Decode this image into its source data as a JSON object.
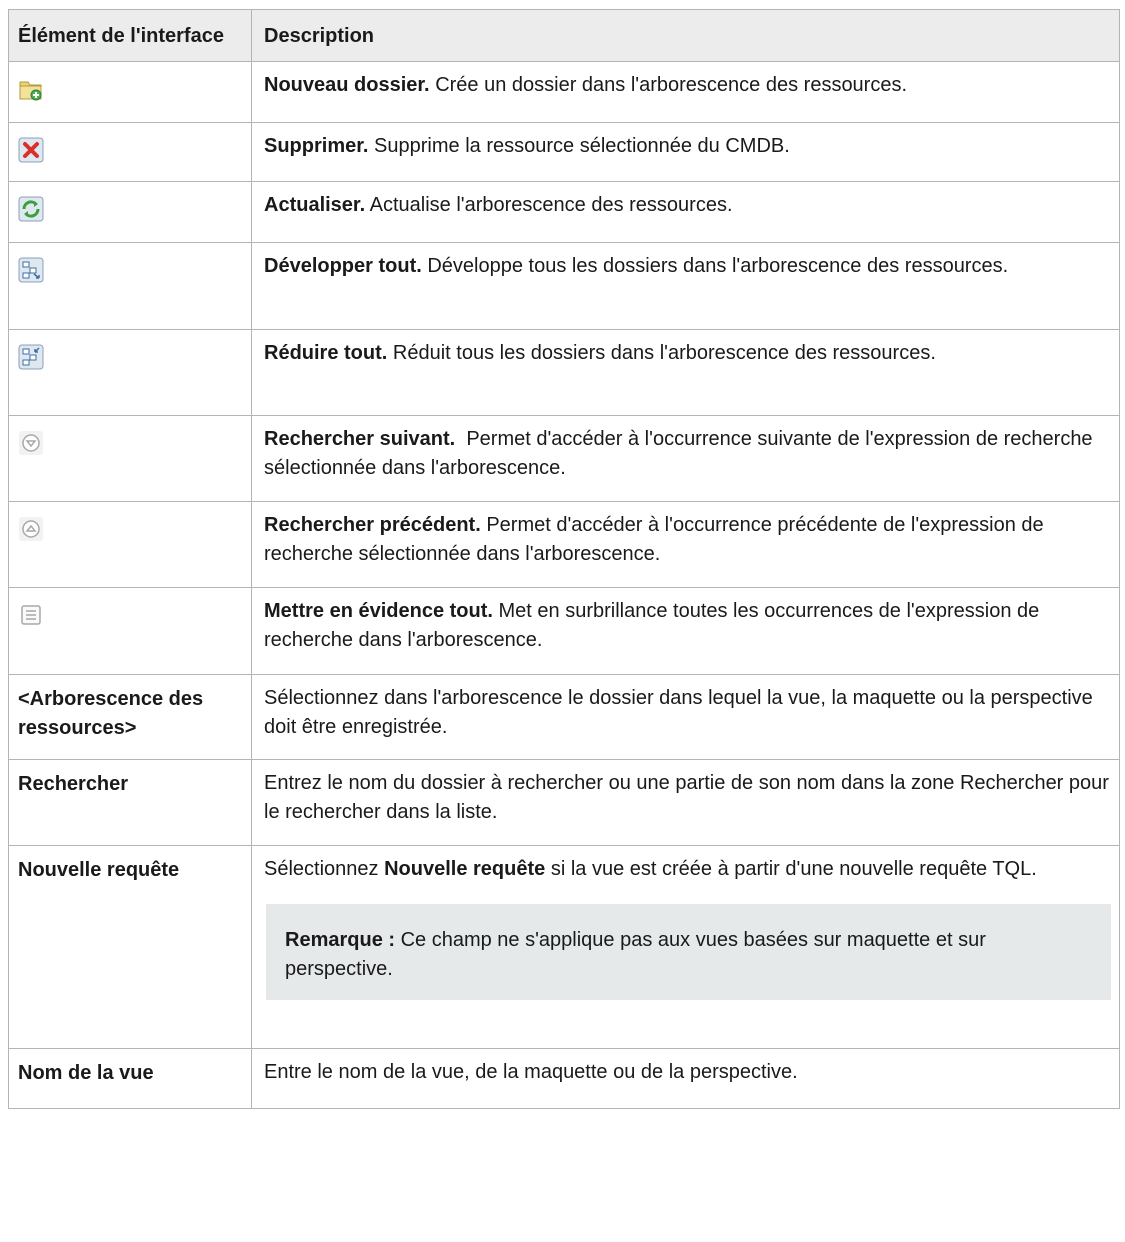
{
  "table": {
    "headers": [
      "Élément de l'interface",
      "Description"
    ],
    "rows": [
      {
        "icon": "new-folder-icon",
        "term": "Nouveau dossier.",
        "desc": "Crée un dossier dans l'arborescence des ressources."
      },
      {
        "icon": "delete-icon",
        "term": "Supprimer.",
        "desc": "Supprime la ressource sélectionnée du CMDB."
      },
      {
        "icon": "refresh-icon",
        "term": "Actualiser.",
        "desc": "Actualise l'arborescence des ressources."
      },
      {
        "icon": "expand-all-icon",
        "term": "Développer tout.",
        "desc": "Développe tous les dossiers dans l'arborescence des ressources."
      },
      {
        "icon": "collapse-all-icon",
        "term": "Réduire tout.",
        "desc": "Réduit tous les dossiers dans l'arborescence des ressources."
      },
      {
        "icon": "find-next-icon",
        "term": "Rechercher suivant.",
        "desc": "Permet d'accéder à l'occurrence suivante de l'expression de recherche sélectionnée dans l'arborescence."
      },
      {
        "icon": "find-previous-icon",
        "term": "Rechercher précédent.",
        "desc": "Permet d'accéder à l'occurrence précédente de l'expression de recherche sélectionnée dans l'arborescence."
      },
      {
        "icon": "highlight-all-icon",
        "term": "Mettre en évidence tout.",
        "desc": "Met en surbrillance toutes les occurrences de l'expression de recherche dans l'arborescence."
      },
      {
        "label": "<Arborescence des ressources>",
        "desc": "Sélectionnez dans l'arborescence le dossier dans lequel la vue, la maquette ou la perspective doit être enregistrée."
      },
      {
        "label": "Rechercher",
        "desc": "Entrez le nom du dossier à rechercher ou une partie de son nom dans la zone Rechercher pour le rechercher dans la liste."
      },
      {
        "label": "Nouvelle requête",
        "desc_pre": "Sélectionnez",
        "desc_bold": "Nouvelle requête",
        "desc_post": "si la vue est créée à partir d'une nouvelle requête TQL.",
        "note_label": "Remarque :",
        "note_text": "Ce champ ne s'applique pas aux vues basées sur maquette et sur perspective."
      },
      {
        "label": "Nom de la vue",
        "desc": "Entre le nom de la vue, de la maquette ou de la perspective."
      }
    ]
  }
}
